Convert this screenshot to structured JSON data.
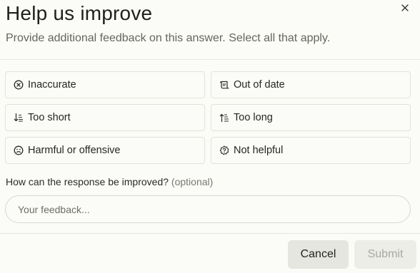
{
  "dialog": {
    "title": "Help us improve",
    "subtitle": "Provide additional feedback on this answer. Select all that apply."
  },
  "options": [
    {
      "label": "Inaccurate",
      "icon": "x-circle-icon"
    },
    {
      "label": "Out of date",
      "icon": "scroll-icon"
    },
    {
      "label": "Too short",
      "icon": "sort-short-icon"
    },
    {
      "label": "Too long",
      "icon": "sort-long-icon"
    },
    {
      "label": "Harmful or offensive",
      "icon": "frown-icon"
    },
    {
      "label": "Not helpful",
      "icon": "question-badge-icon"
    }
  ],
  "feedback": {
    "question": "How can the response be improved?",
    "optional": "(optional)",
    "placeholder": "Your feedback...",
    "value": ""
  },
  "buttons": {
    "cancel": "Cancel",
    "submit": "Submit"
  },
  "colors": {
    "background": "#fbfbf7",
    "border": "#e3e2db",
    "cancel_bg": "#e6e6e0",
    "submit_bg": "#ededE8",
    "submit_text": "#a9a9a3"
  }
}
